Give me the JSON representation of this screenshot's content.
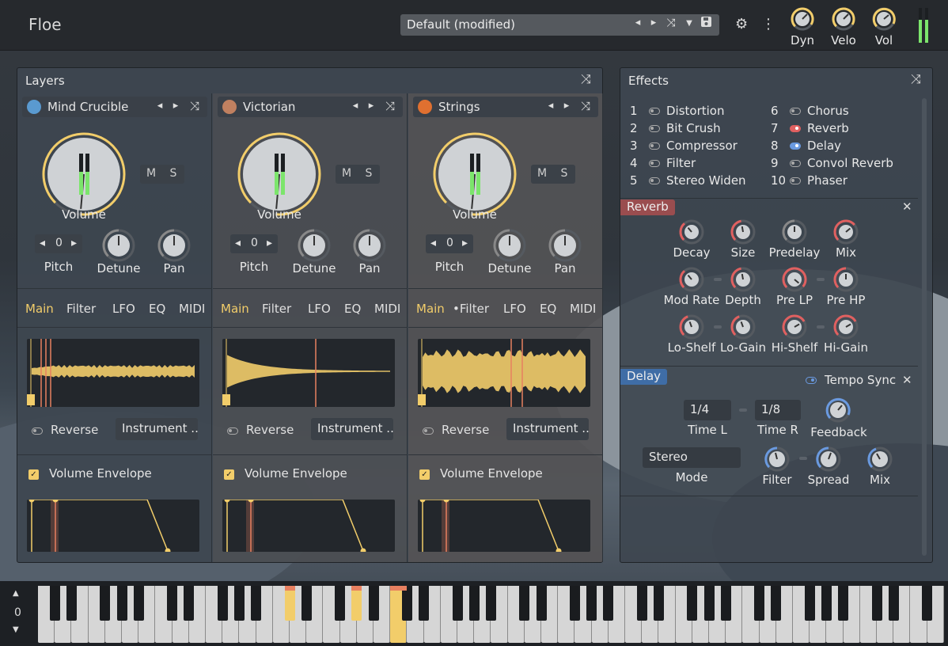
{
  "app": {
    "title": "Floe"
  },
  "preset": {
    "name": "Default (modified)"
  },
  "top_knobs": [
    {
      "label": "Dyn",
      "value": 0.7
    },
    {
      "label": "Velo",
      "value": 0.7
    },
    {
      "label": "Vol",
      "value": 0.75
    }
  ],
  "layers_panel": {
    "title": "Layers",
    "layers": [
      {
        "name": "Mind Crucible",
        "volume_label": "Volume",
        "ms_m": "M",
        "ms_s": "S",
        "pitch_value": "0",
        "pitch_label": "Pitch",
        "detune_label": "Detune",
        "pan_label": "Pan",
        "tabs": [
          "Main",
          "Filter",
          "LFO",
          "EQ",
          "MIDI"
        ],
        "active_tab": "Main",
        "reverse_label": "Reverse",
        "instrument_label": "Instrument ..",
        "env_label": "Volume Envelope",
        "volume": 0.82,
        "icon_color": "#5a9ad0"
      },
      {
        "name": "Victorian",
        "volume_label": "Volume",
        "ms_m": "M",
        "ms_s": "S",
        "pitch_value": "0",
        "pitch_label": "Pitch",
        "detune_label": "Detune",
        "pan_label": "Pan",
        "tabs": [
          "Main",
          "Filter",
          "LFO",
          "EQ",
          "MIDI"
        ],
        "active_tab": "Main",
        "reverse_label": "Reverse",
        "instrument_label": "Instrument ..",
        "env_label": "Volume Envelope",
        "volume": 0.82,
        "icon_color": "#c08060"
      },
      {
        "name": "Strings",
        "volume_label": "Volume",
        "ms_m": "M",
        "ms_s": "S",
        "pitch_value": "0",
        "pitch_label": "Pitch",
        "detune_label": "Detune",
        "pan_label": "Pan",
        "tabs": [
          "Main",
          "•Filter",
          "LFO",
          "EQ",
          "MIDI"
        ],
        "active_tab": "Main",
        "reverse_label": "Reverse",
        "instrument_label": "Instrument ..",
        "env_label": "Volume Envelope",
        "volume": 0.82,
        "icon_color": "#e07030"
      }
    ]
  },
  "effects_panel": {
    "title": "Effects",
    "list": [
      {
        "num": "1",
        "name": "Distortion",
        "on": false
      },
      {
        "num": "2",
        "name": "Bit Crush",
        "on": false
      },
      {
        "num": "3",
        "name": "Compressor",
        "on": false
      },
      {
        "num": "4",
        "name": "Filter",
        "on": false
      },
      {
        "num": "5",
        "name": "Stereo Widen",
        "on": false
      },
      {
        "num": "6",
        "name": "Chorus",
        "on": false
      },
      {
        "num": "7",
        "name": "Reverb",
        "on": true,
        "color": "#e06060"
      },
      {
        "num": "8",
        "name": "Delay",
        "on": true,
        "color": "#6a9ae0"
      },
      {
        "num": "9",
        "name": "Convol Reverb",
        "on": false
      },
      {
        "num": "10",
        "name": "Phaser",
        "on": false
      }
    ],
    "reverb": {
      "title": "Reverb",
      "knobs": [
        "Decay",
        "Size",
        "Predelay",
        "Mix",
        "Mod Rate",
        "Depth",
        "Pre LP",
        "Pre HP",
        "Lo-Shelf",
        "Lo-Gain",
        "Hi-Shelf",
        "Hi-Gain"
      ]
    },
    "delay": {
      "title": "Delay",
      "tempo_sync": "Tempo Sync",
      "time_l_value": "1/4",
      "time_l_label": "Time L",
      "time_r_value": "1/8",
      "time_r_label": "Time R",
      "feedback_label": "Feedback",
      "mode_value": "Stereo",
      "mode_label": "Mode",
      "filter_label": "Filter",
      "spread_label": "Spread",
      "mix_label": "Mix"
    }
  },
  "keyboard": {
    "octave": "0"
  },
  "colors": {
    "accent": "#f2cd6a",
    "reverb": "#e06060",
    "delay": "#6a9ae0",
    "meter": "#7ce56c"
  }
}
